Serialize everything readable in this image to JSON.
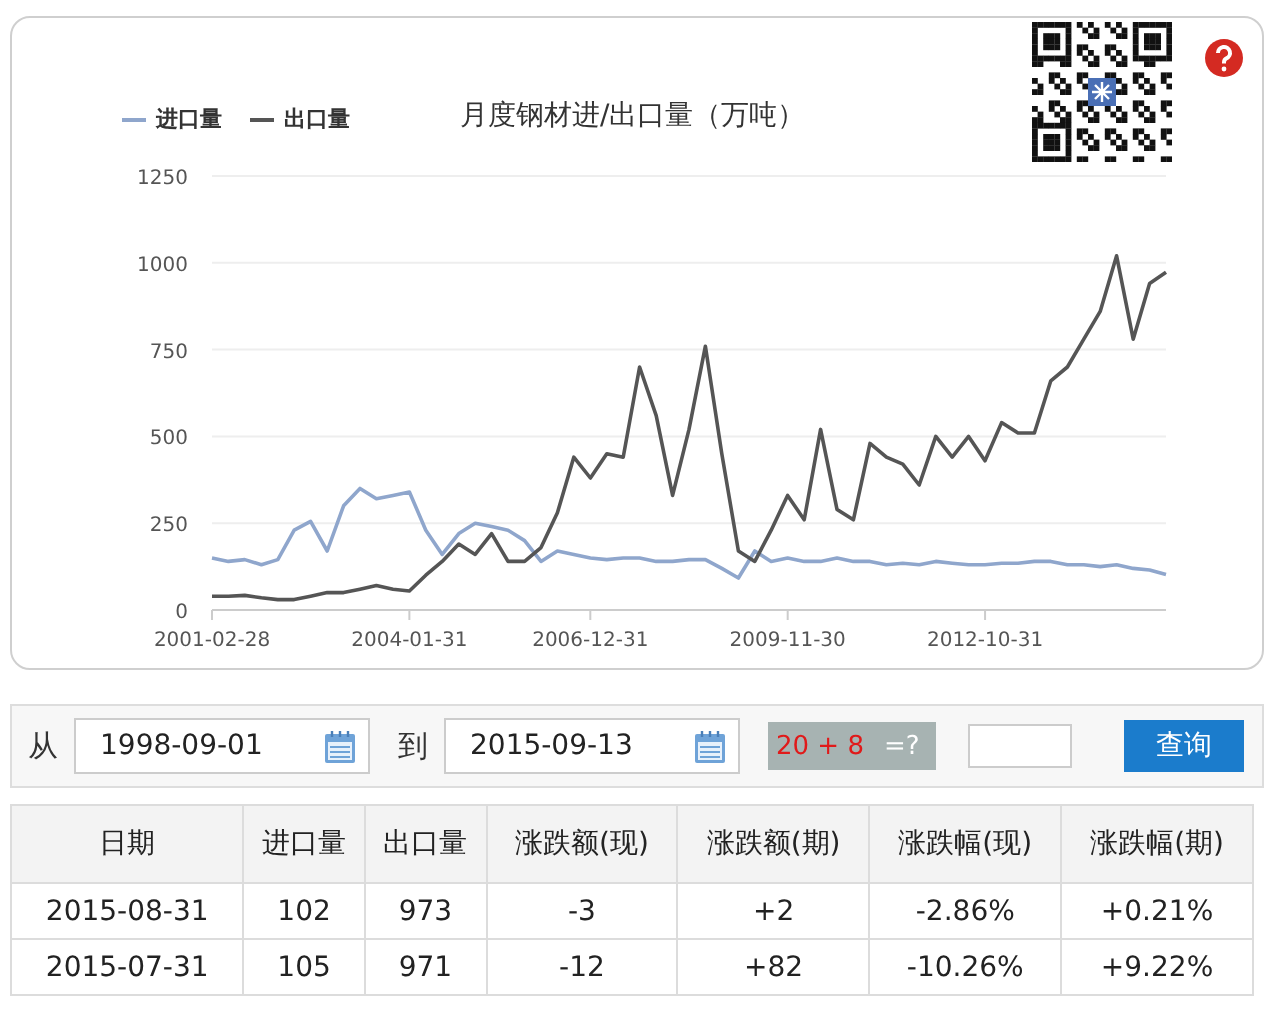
{
  "chart": {
    "chart_data": {
      "type": "line",
      "title": "月度钢材进/出口量（万吨）",
      "categories": [
        "2001-02-28",
        null,
        null,
        null,
        null,
        null,
        null,
        null,
        null,
        null,
        null,
        null,
        "2004-01-31",
        null,
        null,
        null,
        null,
        null,
        null,
        null,
        null,
        null,
        null,
        "2006-12-31",
        null,
        null,
        null,
        null,
        null,
        null,
        null,
        null,
        null,
        null,
        null,
        "2009-11-30",
        null,
        null,
        null,
        null,
        null,
        null,
        null,
        null,
        null,
        null,
        null,
        "2012-10-31",
        null,
        null,
        null,
        null,
        null,
        null,
        null,
        null,
        null,
        null,
        null
      ],
      "series": [
        {
          "name": "进口量",
          "color": "#8fa6cc",
          "values": [
            150,
            140,
            145,
            130,
            145,
            230,
            255,
            170,
            300,
            350,
            320,
            330,
            340,
            230,
            160,
            220,
            250,
            240,
            230,
            200,
            140,
            170,
            160,
            150,
            145,
            150,
            150,
            140,
            140,
            145,
            145,
            120,
            92,
            170,
            140,
            150,
            140,
            140,
            150,
            140,
            140,
            130,
            135,
            130,
            140,
            135,
            130,
            130,
            135,
            135,
            140,
            140,
            130,
            130,
            125,
            130,
            120,
            115,
            102
          ]
        },
        {
          "name": "出口量",
          "color": "#555555",
          "values": [
            40,
            40,
            42,
            35,
            30,
            30,
            40,
            50,
            50,
            60,
            70,
            60,
            55,
            100,
            140,
            190,
            160,
            220,
            140,
            140,
            180,
            280,
            440,
            380,
            450,
            440,
            700,
            560,
            330,
            520,
            760,
            450,
            170,
            140,
            230,
            330,
            260,
            520,
            290,
            260,
            480,
            440,
            420,
            360,
            500,
            440,
            500,
            430,
            540,
            510,
            510,
            660,
            700,
            780,
            860,
            1020,
            780,
            940,
            973
          ]
        }
      ],
      "grid": true,
      "ylim": [
        0,
        1250
      ],
      "yticks": [
        0,
        250,
        500,
        750,
        1000,
        1250
      ]
    }
  },
  "query": {
    "from_label": "从",
    "from_value": "1998-09-01",
    "to_label": "到",
    "to_value": "2015-09-13",
    "captcha_question": "20 + 8",
    "captcha_suffix": "=?",
    "button": "查询"
  },
  "table": {
    "columns": [
      "日期",
      "进口量",
      "出口量",
      "涨跌额(现)",
      "涨跌额(期)",
      "涨跌幅(现)",
      "涨跌幅(期)"
    ],
    "rows": [
      [
        "2015-08-31",
        "102",
        "973",
        "-3",
        "+2",
        "-2.86%",
        "+0.21%"
      ],
      [
        "2015-07-31",
        "105",
        "971",
        "-12",
        "+82",
        "-10.26%",
        "+9.22%"
      ]
    ]
  }
}
